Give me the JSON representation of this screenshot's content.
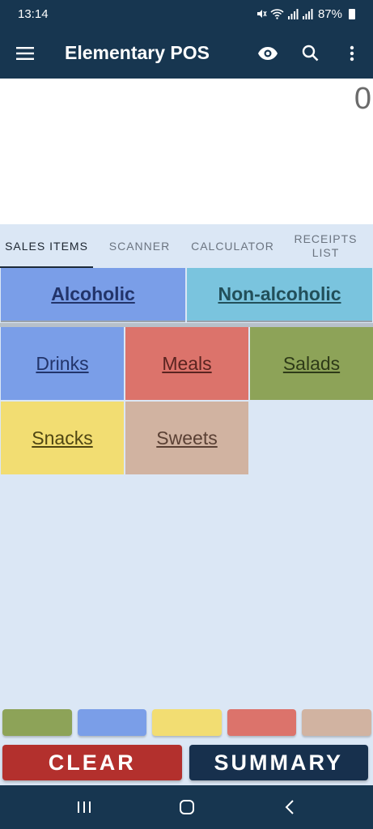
{
  "status_bar": {
    "time": "13:14",
    "battery": "87%"
  },
  "app_bar": {
    "title": "Elementary POS",
    "icons": [
      "menu-icon",
      "eye-icon",
      "search-icon",
      "more-vert-icon"
    ]
  },
  "display": {
    "value": "0"
  },
  "tabs": [
    {
      "label": "SALES ITEMS",
      "active": true
    },
    {
      "label": "SCANNER",
      "active": false
    },
    {
      "label": "CALCULATOR",
      "active": false
    },
    {
      "label": "RECEIPTS LIST",
      "active": false
    }
  ],
  "groups": [
    {
      "label": "Alcoholic",
      "color": "#7a9ee8",
      "text_color": "#22346a"
    },
    {
      "label": "Non-alcoholic",
      "color": "#7ac4de",
      "text_color": "#224f5a"
    }
  ],
  "categories": [
    {
      "label": "Drinks",
      "color": "#7a9ee8",
      "text_color": "#22346a"
    },
    {
      "label": "Meals",
      "color": "#dc736b",
      "text_color": "#5a2420"
    },
    {
      "label": "Salads",
      "color": "#8da358",
      "text_color": "#2e3a18"
    },
    {
      "label": "Snacks",
      "color": "#f2dd72",
      "text_color": "#4f4512"
    },
    {
      "label": "Sweets",
      "color": "#d1b3a1",
      "text_color": "#5a4034"
    }
  ],
  "swatches": [
    "#8da358",
    "#7a9ee8",
    "#f2dd72",
    "#dc736b",
    "#d1b3a1"
  ],
  "buttons": {
    "clear": {
      "label": "CLEAR",
      "color": "#b3302d"
    },
    "summary": {
      "label": "SUMMARY",
      "color": "#17304d"
    }
  }
}
